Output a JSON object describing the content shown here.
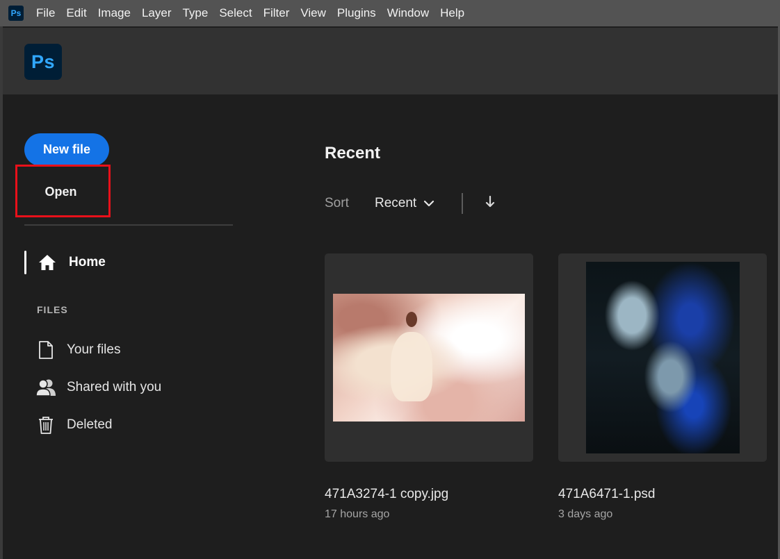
{
  "menubar": {
    "app_icon": "Ps",
    "items": [
      "File",
      "Edit",
      "Image",
      "Layer",
      "Type",
      "Select",
      "Filter",
      "View",
      "Plugins",
      "Window",
      "Help"
    ]
  },
  "header": {
    "logo_text": "Ps"
  },
  "sidebar": {
    "new_file_label": "New file",
    "open_label": "Open",
    "home_label": "Home",
    "files_heading": "FILES",
    "items": [
      {
        "label": "Your files",
        "icon": "document-icon"
      },
      {
        "label": "Shared with you",
        "icon": "people-icon"
      },
      {
        "label": "Deleted",
        "icon": "trash-icon"
      }
    ]
  },
  "main": {
    "title": "Recent",
    "sort_label": "Sort",
    "sort_value": "Recent",
    "files": [
      {
        "name": "471A3274-1 copy.jpg",
        "time": "17 hours ago"
      },
      {
        "name": "471A6471-1.psd",
        "time": "3 days ago"
      }
    ]
  },
  "colors": {
    "accent": "#1473e6",
    "highlight": "#e8101a",
    "ps_blue": "#31a8ff",
    "ps_dark": "#001e36"
  }
}
